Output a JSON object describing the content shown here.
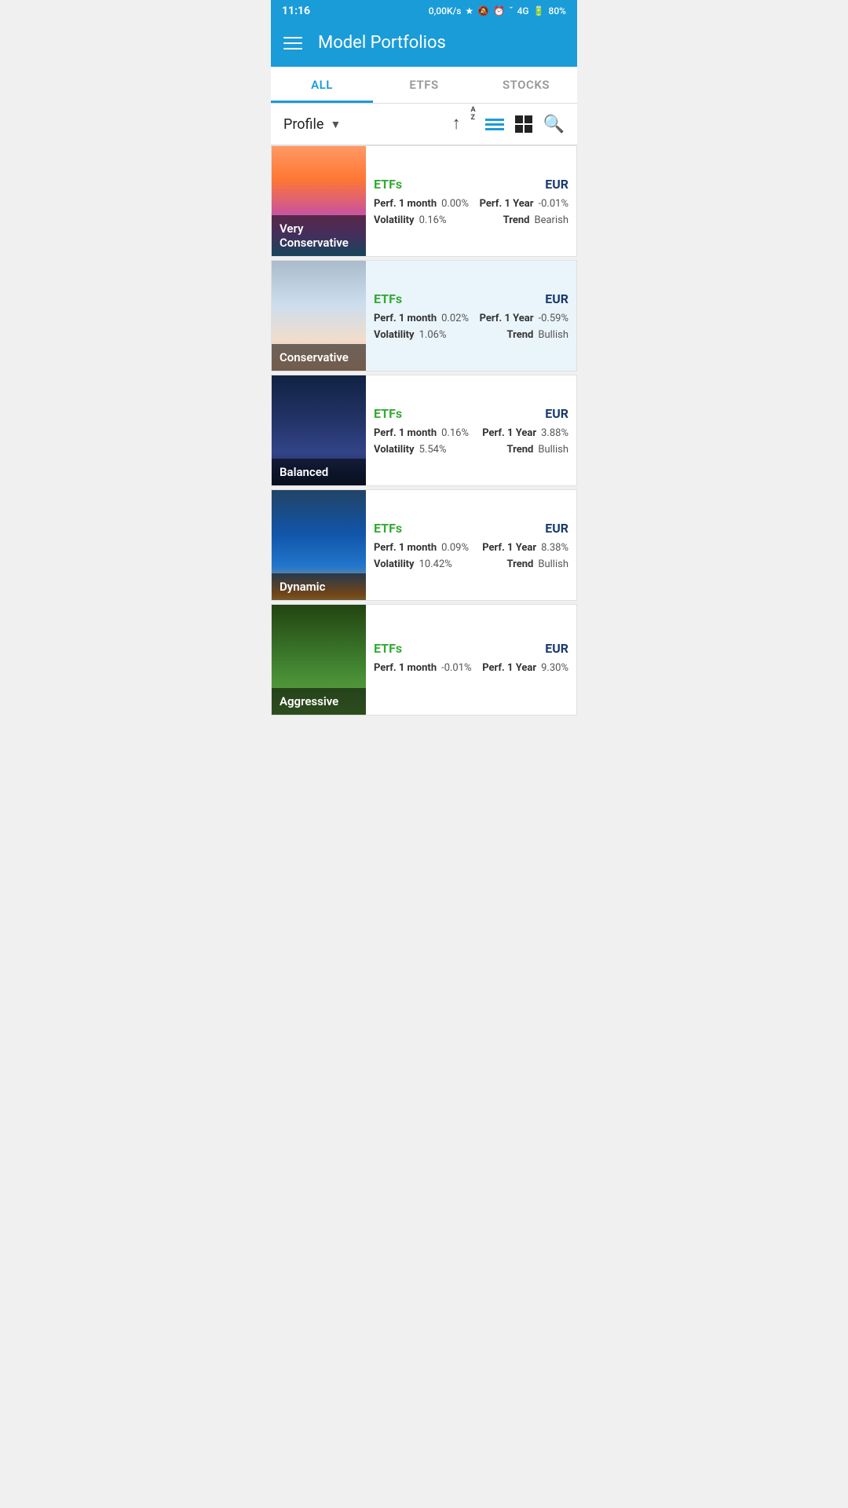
{
  "statusBar": {
    "time": "11:16",
    "network": "0,00K/s",
    "signal": "4G",
    "battery": "80%"
  },
  "header": {
    "title": "Model Portfolios"
  },
  "tabs": [
    {
      "id": "all",
      "label": "ALL",
      "active": true
    },
    {
      "id": "etfs",
      "label": "ETFS",
      "active": false
    },
    {
      "id": "stocks",
      "label": "STOCKS",
      "active": false
    }
  ],
  "toolbar": {
    "profile_label": "Profile",
    "sort_label": "Sort A-Z",
    "sort_top": "A",
    "sort_bottom": "Z"
  },
  "portfolios": [
    {
      "id": "very-conservative",
      "name": "Very Conservative",
      "type": "ETFs",
      "currency": "EUR",
      "perf1month": "0.00%",
      "perf1year": "-0.01%",
      "volatility": "0.16%",
      "trend": "Bearish",
      "highlighted": false,
      "thumbClass": "thumb-very-conservative"
    },
    {
      "id": "conservative",
      "name": "Conservative",
      "type": "ETFs",
      "currency": "EUR",
      "perf1month": "0.02%",
      "perf1year": "-0.59%",
      "volatility": "1.06%",
      "trend": "Bullish",
      "highlighted": true,
      "thumbClass": "thumb-conservative"
    },
    {
      "id": "balanced",
      "name": "Balanced",
      "type": "ETFs",
      "currency": "EUR",
      "perf1month": "0.16%",
      "perf1year": "3.88%",
      "volatility": "5.54%",
      "trend": "Bullish",
      "highlighted": false,
      "thumbClass": "thumb-balanced"
    },
    {
      "id": "dynamic",
      "name": "Dynamic",
      "type": "ETFs",
      "currency": "EUR",
      "perf1month": "0.09%",
      "perf1year": "8.38%",
      "volatility": "10.42%",
      "trend": "Bullish",
      "highlighted": false,
      "thumbClass": "thumb-dynamic"
    },
    {
      "id": "aggressive",
      "name": "Aggressive",
      "type": "ETFs",
      "currency": "EUR",
      "perf1month": "-0.01%",
      "perf1year": "9.30%",
      "volatility": "",
      "trend": "",
      "highlighted": false,
      "thumbClass": "thumb-aggressive"
    }
  ],
  "labels": {
    "perf1month": "Perf. 1 month",
    "perf1year": "Perf. 1 Year",
    "volatility": "Volatility",
    "trend": "Trend"
  }
}
